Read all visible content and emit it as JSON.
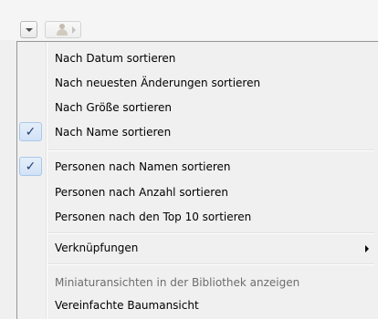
{
  "toolbar": {
    "dropdown_icon": "chevron-down-icon",
    "people_icon": "person-icon"
  },
  "menu": {
    "items": [
      {
        "label": "Nach Datum sortieren",
        "checked": false
      },
      {
        "label": "Nach neuesten Änderungen sortieren",
        "checked": false
      },
      {
        "label": "Nach Größe sortieren",
        "checked": false
      },
      {
        "label": "Nach Name sortieren",
        "checked": true
      },
      {
        "label": "Personen nach Namen sortieren",
        "checked": true
      },
      {
        "label": "Personen nach Anzahl sortieren",
        "checked": false
      },
      {
        "label": "Personen nach den Top 10 sortieren",
        "checked": false
      },
      {
        "label": "Verknüpfungen",
        "submenu": true
      },
      {
        "label": "Miniaturansichten in der Bibliothek anzeigen",
        "disabled": true
      },
      {
        "label": "Vereinfachte Baumansicht",
        "checked": false
      }
    ],
    "check_glyph": "✓"
  }
}
